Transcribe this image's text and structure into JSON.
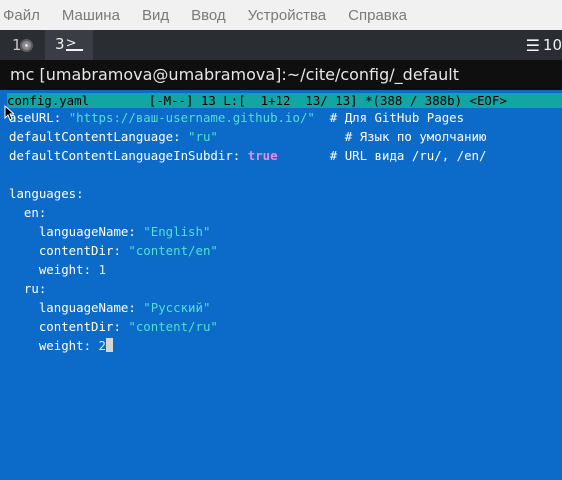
{
  "menubar": {
    "items": [
      "Файл",
      "Машина",
      "Вид",
      "Ввод",
      "Устройства",
      "Справка"
    ]
  },
  "tabs": {
    "tab1_number": "1",
    "tab2_number": "3",
    "tab2_prompt": ">_",
    "menu_label": "10"
  },
  "title": "mc [umabramova@umabramova]:~/cite/config/_default",
  "editor": {
    "status": "config.yaml        [-M--] 13 L:[  1+12  13/ 13] *(388 / 388b) <EOF>",
    "lines": [
      {
        "key": "aseURL:",
        "value": "\"https://ваш-username.github.io/\"",
        "comment": "# Для GitHub Pages"
      },
      {
        "key": "defaultContentLanguage:",
        "value": "\"ru\"",
        "comment": "# Язык по умолчанию"
      },
      {
        "key": "defaultContentLanguageInSubdir:",
        "value": "true",
        "comment": "# URL вида /ru/, /en/"
      },
      {
        "key": "languages:"
      },
      {
        "key": "en:"
      },
      {
        "key": "languageName:",
        "value": "\"English\""
      },
      {
        "key": "contentDir:",
        "value": "\"content/en\""
      },
      {
        "key": "weight:",
        "value": "1"
      },
      {
        "key": "ru:"
      },
      {
        "key": "languageName:",
        "value": "\"Русский\""
      },
      {
        "key": "contentDir:",
        "value": "\"content/ru\""
      },
      {
        "key": "weight:",
        "value": "2"
      }
    ]
  },
  "colors": {
    "terminal_background": "#0c6ac9",
    "status_background": "#11a6a4",
    "string_color": "#53dfd4",
    "boolean_color": "#e88dde"
  }
}
